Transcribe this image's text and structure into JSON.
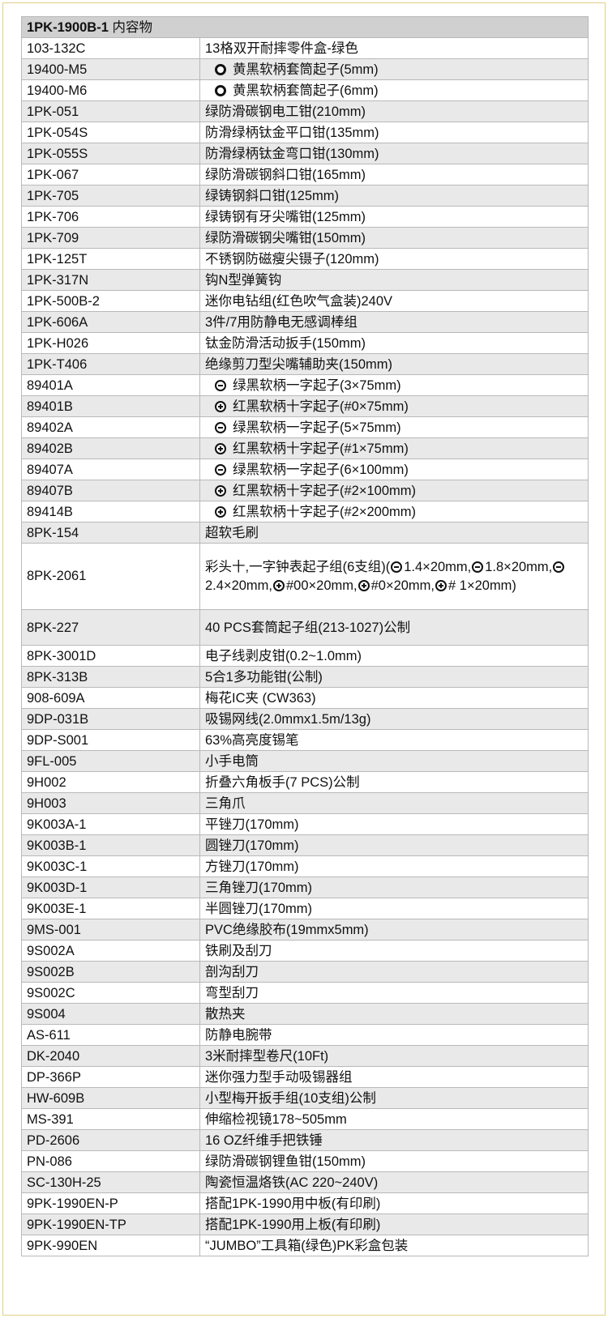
{
  "header": {
    "model": "1PK-1900B-1",
    "subtitle": "内容物"
  },
  "rows": [
    {
      "code": "103-132C",
      "desc": "13格双开耐摔零件盒-绿色"
    },
    {
      "code": "19400-M5",
      "desc": "黄黑软柄套筒起子(5mm)",
      "icon": "socket-icon"
    },
    {
      "code": "19400-M6",
      "desc": "黄黑软柄套筒起子(6mm)",
      "icon": "socket-icon"
    },
    {
      "code": "1PK-051",
      "desc": "绿防滑碳钢电工钳(210mm)"
    },
    {
      "code": "1PK-054S",
      "desc": "防滑绿柄钛金平口钳(135mm)"
    },
    {
      "code": "1PK-055S",
      "desc": "防滑绿柄钛金弯口钳(130mm)"
    },
    {
      "code": "1PK-067",
      "desc": "绿防滑碳钢斜口钳(165mm)"
    },
    {
      "code": "1PK-705",
      "desc": "绿铸钢斜口钳(125mm)"
    },
    {
      "code": "1PK-706",
      "desc": "绿铸钢有牙尖嘴钳(125mm)"
    },
    {
      "code": "1PK-709",
      "desc": "绿防滑碳钢尖嘴钳(150mm)"
    },
    {
      "code": "1PK-125T",
      "desc": "不锈钢防磁瘦尖镊子(120mm)"
    },
    {
      "code": "1PK-317N",
      "desc": "钩N型弹簧钩"
    },
    {
      "code": "1PK-500B-2",
      "desc": "迷你电钻组(红色吹气盒装)240V"
    },
    {
      "code": "1PK-606A",
      "desc": "3件/7用防静电无感调棒组"
    },
    {
      "code": "1PK-H026",
      "desc": "钛金防滑活动扳手(150mm)"
    },
    {
      "code": "1PK-T406",
      "desc": "绝缘剪刀型尖嘴辅助夹(150mm)"
    },
    {
      "code": "89401A",
      "desc": "绿黑软柄一字起子(3×75mm)",
      "icon": "slotted-screwdriver-icon"
    },
    {
      "code": "89401B",
      "desc": "红黑软柄十字起子(#0×75mm)",
      "icon": "phillips-screwdriver-icon"
    },
    {
      "code": "89402A",
      "desc": "绿黑软柄一字起子(5×75mm)",
      "icon": "slotted-screwdriver-icon"
    },
    {
      "code": "89402B",
      "desc": "红黑软柄十字起子(#1×75mm)",
      "icon": "phillips-screwdriver-icon"
    },
    {
      "code": "89407A",
      "desc": "绿黑软柄一字起子(6×100mm)",
      "icon": "slotted-screwdriver-icon"
    },
    {
      "code": "89407B",
      "desc": "红黑软柄十字起子(#2×100mm)",
      "icon": "phillips-screwdriver-icon"
    },
    {
      "code": "89414B",
      "desc": "红黑软柄十字起子(#2×200mm)",
      "icon": "phillips-screwdriver-icon"
    },
    {
      "code": "8PK-154",
      "desc": "超软毛刷"
    },
    {
      "code": "8PK-2061",
      "desc_parts": [
        "彩头十,一字钟表起子组(6支组)(",
        "1.4×20mm,",
        "1.8×20mm,",
        "2.4×20mm,",
        "#00×20mm,",
        "#0×20mm,",
        "# 1×20mm)"
      ]
    },
    {
      "code": "8PK-227",
      "desc": "40 PCS套筒起子组(213-1027)公制"
    },
    {
      "code": "8PK-3001D",
      "desc": "电子线剥皮钳(0.2~1.0mm)"
    },
    {
      "code": "8PK-313B",
      "desc": "5合1多功能钳(公制)"
    },
    {
      "code": "908-609A",
      "desc": "梅花IC夹 (CW363)"
    },
    {
      "code": "9DP-031B",
      "desc": "吸锡网线(2.0mmx1.5m/13g)"
    },
    {
      "code": "9DP-S001",
      "desc": "63%高亮度锡笔"
    },
    {
      "code": "9FL-005",
      "desc": "小手电筒"
    },
    {
      "code": "9H002",
      "desc": "折叠六角板手(7 PCS)公制"
    },
    {
      "code": "9H003",
      "desc": "三角爪"
    },
    {
      "code": "9K003A-1",
      "desc": "平锉刀(170mm)"
    },
    {
      "code": "9K003B-1",
      "desc": "圆锉刀(170mm)"
    },
    {
      "code": "9K003C-1",
      "desc": "方锉刀(170mm)"
    },
    {
      "code": "9K003D-1",
      "desc": "三角锉刀(170mm)"
    },
    {
      "code": "9K003E-1",
      "desc": "半圆锉刀(170mm)"
    },
    {
      "code": "9MS-001",
      "desc": "PVC绝缘胶布(19mmx5mm)"
    },
    {
      "code": "9S002A",
      "desc": "铁刷及刮刀"
    },
    {
      "code": "9S002B",
      "desc": "剖沟刮刀"
    },
    {
      "code": "9S002C",
      "desc": "弯型刮刀"
    },
    {
      "code": "9S004",
      "desc": "散热夹"
    },
    {
      "code": "AS-611",
      "desc": "防静电腕带"
    },
    {
      "code": "DK-2040",
      "desc": "3米耐摔型卷尺(10Ft)"
    },
    {
      "code": "DP-366P",
      "desc": "迷你强力型手动吸锡器组"
    },
    {
      "code": "HW-609B",
      "desc": "小型梅开扳手组(10支组)公制"
    },
    {
      "code": "MS-391",
      "desc": "伸缩检视镜178~505mm"
    },
    {
      "code": "PD-2606",
      "desc": "16 OZ纤维手把铁锤"
    },
    {
      "code": "PN-086",
      "desc": "绿防滑碳钢锂鱼钳(150mm)"
    },
    {
      "code": "SC-130H-25",
      "desc": "陶瓷恒温烙铁(AC 220~240V)"
    },
    {
      "code": "9PK-1990EN-P",
      "desc": "搭配1PK-1990用中板(有印刷)"
    },
    {
      "code": "9PK-1990EN-TP",
      "desc": "搭配1PK-1990用上板(有印刷)"
    },
    {
      "code": "9PK-990EN",
      "desc": "“JUMBO”工具箱(绿色)PK彩盒包装"
    }
  ]
}
